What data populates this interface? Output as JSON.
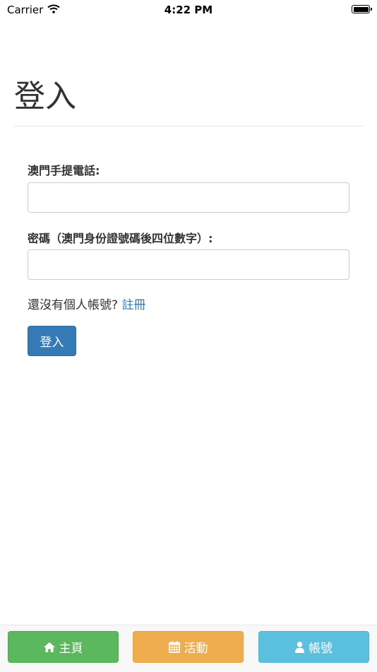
{
  "status_bar": {
    "carrier": "Carrier",
    "time": "4:22 PM"
  },
  "page": {
    "title": "登入"
  },
  "form": {
    "phone_label": "澳門手提電話:",
    "phone_value": "",
    "password_label": "密碼（澳門身份證號碼後四位數字）:",
    "password_value": "",
    "register_prompt": "還沒有個人帳號? ",
    "register_link": "註冊",
    "login_button": "登入"
  },
  "tab_bar": {
    "home": {
      "label": "主頁",
      "icon": "home-icon",
      "color": "#5cb85c"
    },
    "events": {
      "label": "活動",
      "icon": "calendar-icon",
      "color": "#f0ad4e"
    },
    "account": {
      "label": "帳號",
      "icon": "user-icon",
      "color": "#5bc0de"
    }
  },
  "colors": {
    "primary": "#337ab7",
    "success": "#5cb85c",
    "warning": "#f0ad4e",
    "info": "#5bc0de"
  }
}
